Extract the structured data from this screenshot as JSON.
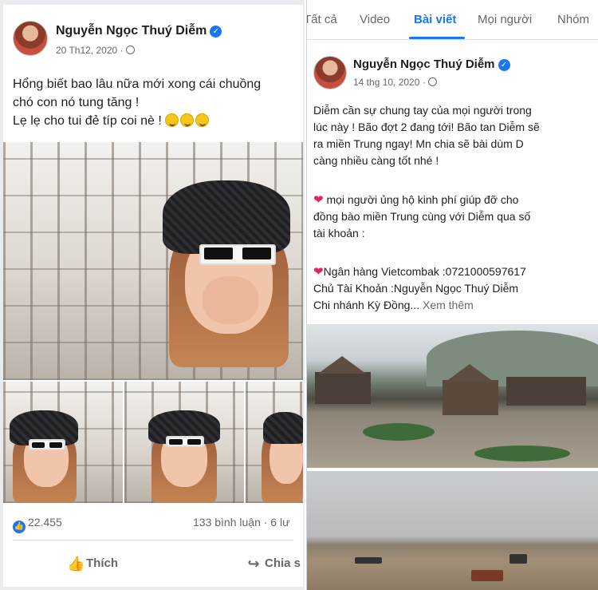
{
  "left_post": {
    "author": "Nguyễn Ngọc Thuý Diễm",
    "date": "20 Th12, 2020",
    "text_lines": [
      "Hổng biết bao lâu nữa mới xong cái chuồng",
      "chó con nó tung tăng !",
      "Lẹ lẹ cho tui đẻ típ coi nè  !"
    ],
    "likes": "22.455",
    "comments": "133 bình luận",
    "shares": "· 6 lư",
    "like_label": "Thích",
    "share_label": "Chia s"
  },
  "right_tabs": [
    "Tất cả",
    "Video",
    "Bài viết",
    "Mọi người",
    "Nhóm"
  ],
  "right_post": {
    "author": "Nguyễn Ngọc Thuý Diễm",
    "date": "14 thg 10, 2020",
    "para1": [
      "Diễm cần sự chung tay của mọi người trong",
      "lúc này ! Bão đợt 2 đang tới! Bão tan Diễm sẽ",
      "ra miền Trung ngay! Mn chia sẽ bài dùm D",
      "càng nhiều càng tốt nhé !"
    ],
    "para2": [
      "mọi người ủng hộ kinh phí giúp đỡ cho",
      "đồng bào miền Trung cùng với Diễm qua số",
      "tài khoản :"
    ],
    "bank_line": "Ngân hàng Vietcombak :0721000597617",
    "owner_line": "Chủ Tài Khoản :Nguyễn Ngọc Thuý Diễm",
    "branch_line": "Chi nhánh Kỳ Đồng...",
    "see_more": "Xem thêm"
  },
  "colors": {
    "facebook_blue": "#1877f2",
    "text_primary": "#1c1e21",
    "text_secondary": "#65676b"
  },
  "icons": [
    "globe-icon",
    "verified-badge-icon",
    "like-icon",
    "share-icon",
    "heart-icon",
    "grinning-emoji-icon"
  ]
}
